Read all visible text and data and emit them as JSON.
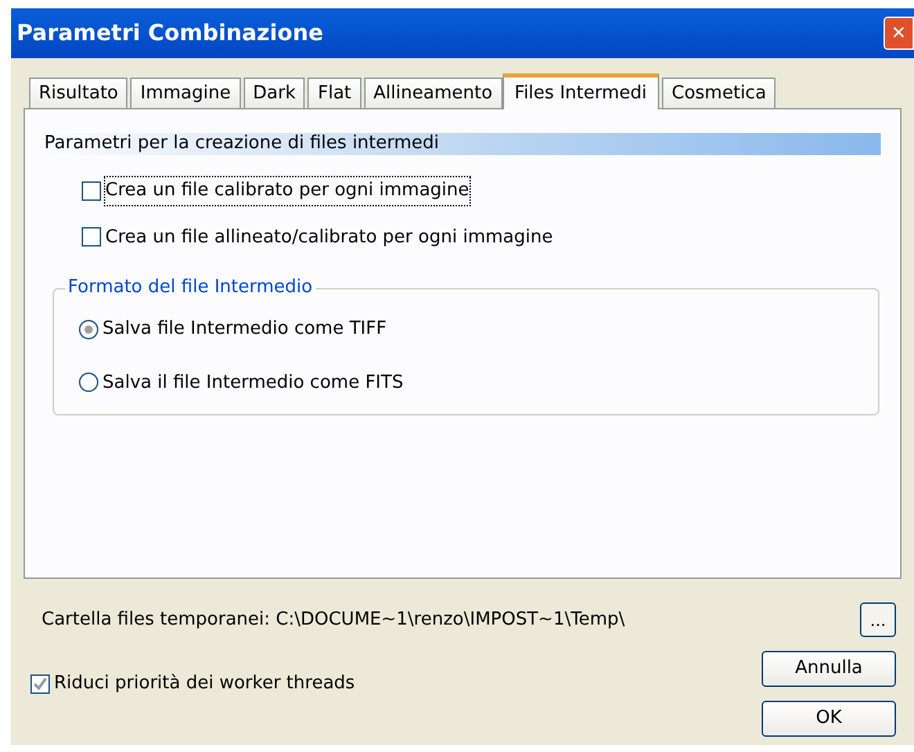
{
  "window": {
    "title": "Parametri Combinazione",
    "close": "✕"
  },
  "tabs": [
    {
      "label": "Risultato",
      "selected": false
    },
    {
      "label": "Immagine",
      "selected": false
    },
    {
      "label": "Dark",
      "selected": false
    },
    {
      "label": "Flat",
      "selected": false
    },
    {
      "label": "Allineamento",
      "selected": false
    },
    {
      "label": "Files Intermedi",
      "selected": true
    },
    {
      "label": "Cosmetica",
      "selected": false
    }
  ],
  "section_header": "Parametri per la creazione di files intermedi",
  "checkboxes": [
    {
      "label": "Crea un file calibrato per ogni immagine",
      "checked": false,
      "focused": true
    },
    {
      "label": "Crea un file allineato/calibrato per ogni immagine",
      "checked": false,
      "focused": false
    }
  ],
  "format_group": {
    "title": "Formato del file Intermedio",
    "options": [
      {
        "label": "Salva file Intermedio come TIFF",
        "selected": true
      },
      {
        "label": "Salva il file Intermedio come FITS",
        "selected": false
      }
    ]
  },
  "temp_folder": {
    "label": "Cartella files temporanei: C:\\DOCUME~1\\renzo\\IMPOST~1\\Temp\\",
    "browse": "..."
  },
  "reduce_priority": {
    "label": "Riduci priorità dei worker threads",
    "checked": true
  },
  "buttons": [
    "Annulla",
    "OK"
  ]
}
